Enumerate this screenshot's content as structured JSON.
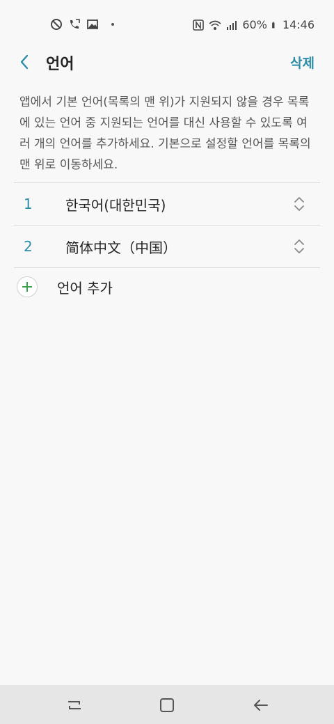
{
  "status_bar": {
    "battery": "60%",
    "time": "14:46",
    "icons_left": [
      "do-not-disturb-icon",
      "call-forward-icon",
      "image-icon",
      "dot-icon"
    ],
    "icons_right": [
      "nfc-icon",
      "wifi-icon",
      "signal-icon",
      "battery-icon"
    ]
  },
  "app_bar": {
    "title": "언어",
    "action": "삭제"
  },
  "description": "앱에서 기본 언어(목록의 맨 위)가 지원되지 않을 경우 목록에 있는 언어 중 지원되는 언어를 대신 사용할 수 있도록 여러 개의 언어를 추가하세요. 기본으로 설정할 언어를 목록의 맨 위로 이동하세요.",
  "languages": [
    {
      "index": "1",
      "name": "한국어(대한민국)"
    },
    {
      "index": "2",
      "name": "简体中文（中国）"
    }
  ],
  "add_language": "언어 추가",
  "colors": {
    "accent": "#2b8da7",
    "add_icon": "#3aa04a",
    "background": "#f8f8f8"
  }
}
